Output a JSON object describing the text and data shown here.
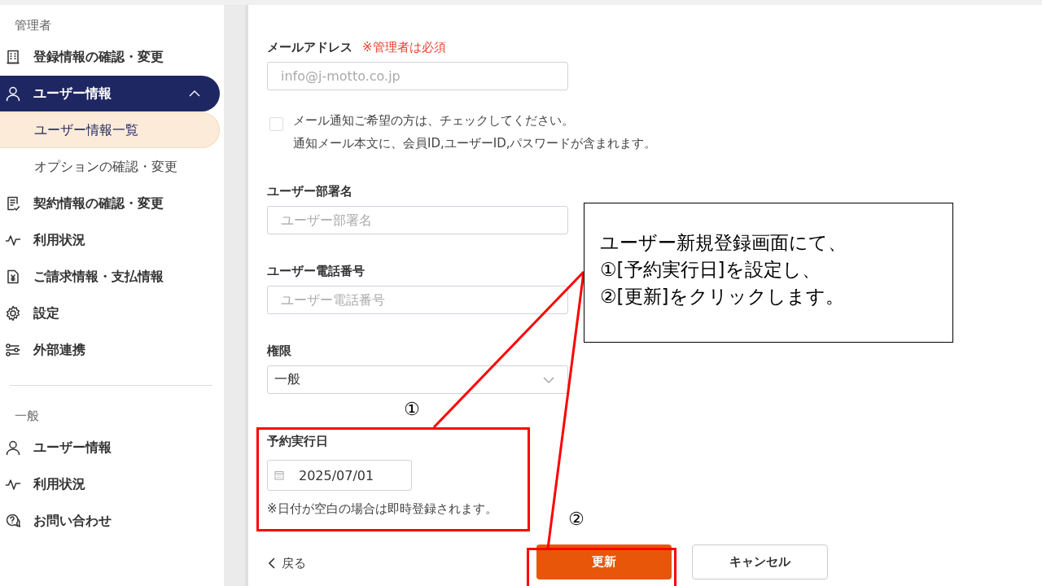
{
  "sidebar": {
    "sections": [
      {
        "title": "管理者",
        "items": [
          {
            "label": "登録情報の確認・変更",
            "selected": false
          },
          {
            "label": "ユーザー情報",
            "selected": true,
            "expanded": true,
            "children": [
              {
                "label": "ユーザー情報一覧",
                "selected": true
              },
              {
                "label": "オプションの確認・変更",
                "selected": false
              }
            ]
          },
          {
            "label": "契約情報の確認・変更",
            "selected": false
          },
          {
            "label": "利用状況",
            "selected": false
          },
          {
            "label": "ご請求情報・支払情報",
            "selected": false
          },
          {
            "label": "設定",
            "selected": false
          },
          {
            "label": "外部連携",
            "selected": false
          }
        ]
      },
      {
        "title": "一般",
        "items": [
          {
            "label": "ユーザー情報",
            "selected": false
          },
          {
            "label": "利用状況",
            "selected": false
          },
          {
            "label": "お問い合わせ",
            "selected": false
          }
        ]
      }
    ]
  },
  "form": {
    "fields": [
      {
        "kind": "email",
        "label": "メールアドレス",
        "required_note": "※管理者は必須",
        "placeholder": "info@j-motto.co.jp"
      },
      {
        "kind": "checkbox",
        "checked": false,
        "lines": [
          "メール通知ご希望の方は、チェックしてください。",
          "通知メール本文に、会員ID,ユーザーID,パスワードが含まれます。"
        ]
      },
      {
        "kind": "text",
        "label": "ユーザー部署名",
        "placeholder": "ユーザー部署名"
      },
      {
        "kind": "text",
        "label": "ユーザー電話番号",
        "placeholder": "ユーザー電話番号"
      },
      {
        "kind": "select",
        "label": "権限",
        "value": "一般"
      },
      {
        "kind": "date",
        "label": "予約実行日",
        "value": "2025/07/01",
        "note": "※日付が空白の場合は即時登録されます。"
      }
    ],
    "back_link": "戻る",
    "buttons": [
      {
        "kind": "primary",
        "label": "更新"
      },
      {
        "kind": "secondary",
        "label": "キャンセル"
      }
    ]
  },
  "annotation": {
    "lines": [
      "ユーザー新規登録画面にて、",
      "①[予約実行日]を設定し、",
      "②[更新]をクリックします。"
    ],
    "markers": [
      "①",
      "②"
    ]
  }
}
